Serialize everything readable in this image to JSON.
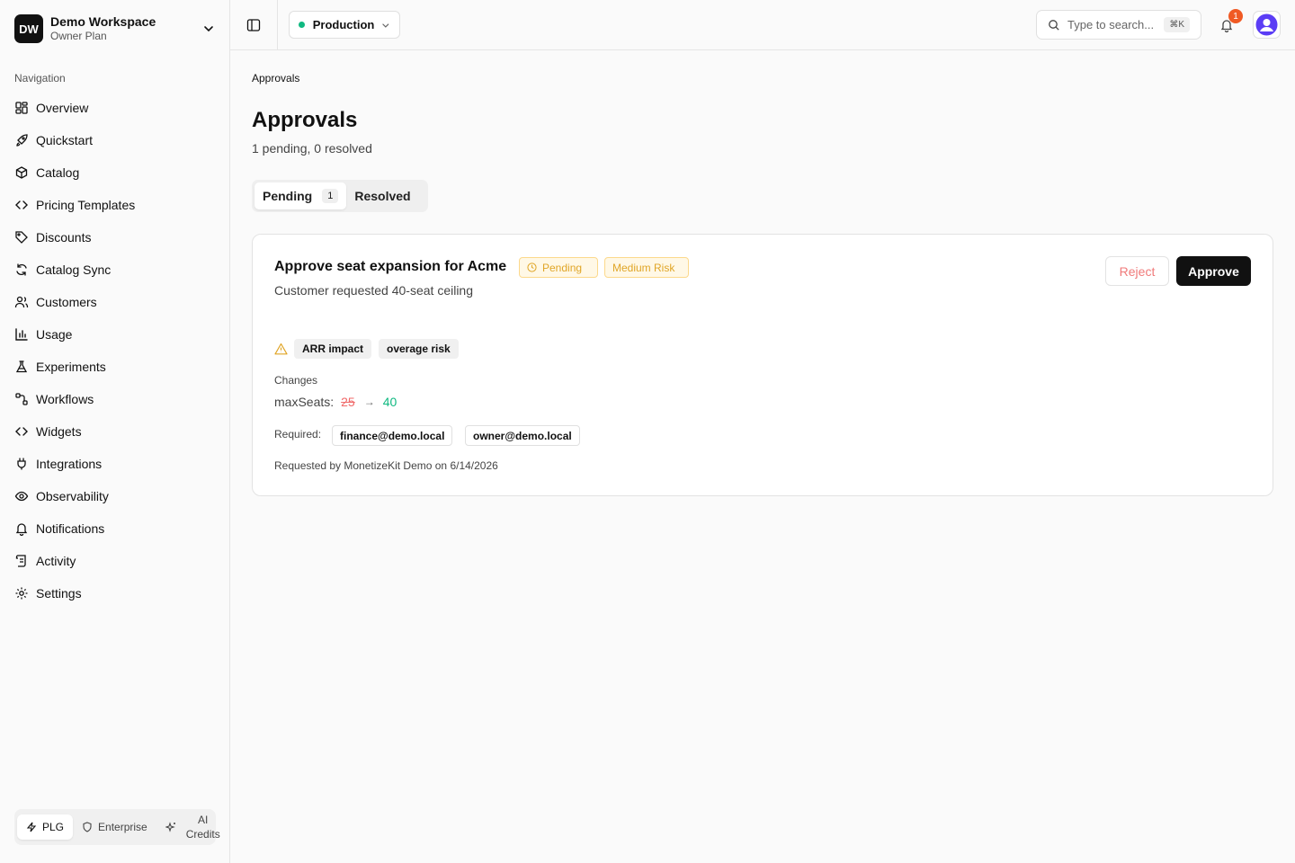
{
  "workspace": {
    "initials": "DW",
    "name": "Demo Workspace",
    "plan": "Owner Plan"
  },
  "nav": {
    "title": "Navigation",
    "items": [
      {
        "label": "Overview",
        "icon": "grid-icon"
      },
      {
        "label": "Quickstart",
        "icon": "rocket-icon"
      },
      {
        "label": "Catalog",
        "icon": "box-icon"
      },
      {
        "label": "Pricing Templates",
        "icon": "code-icon"
      },
      {
        "label": "Discounts",
        "icon": "tag-icon"
      },
      {
        "label": "Catalog Sync",
        "icon": "refresh-icon"
      },
      {
        "label": "Customers",
        "icon": "users-icon"
      },
      {
        "label": "Usage",
        "icon": "bar-chart-icon"
      },
      {
        "label": "Experiments",
        "icon": "flask-icon"
      },
      {
        "label": "Workflows",
        "icon": "workflow-icon"
      },
      {
        "label": "Widgets",
        "icon": "code-icon"
      },
      {
        "label": "Integrations",
        "icon": "plug-icon"
      },
      {
        "label": "Observability",
        "icon": "eye-icon"
      },
      {
        "label": "Notifications",
        "icon": "bell-icon"
      },
      {
        "label": "Activity",
        "icon": "scroll-icon"
      },
      {
        "label": "Settings",
        "icon": "gear-icon"
      }
    ]
  },
  "plan_switch": {
    "plg": "PLG",
    "enterprise": "Enterprise",
    "ai_credits": "AI Credits"
  },
  "topbar": {
    "environment": "Production",
    "search_placeholder": "Type to search...",
    "search_shortcut": "⌘K",
    "notification_count": "1"
  },
  "page": {
    "breadcrumb": "Approvals",
    "title": "Approvals",
    "subtitle": "1 pending, 0 resolved"
  },
  "tabs": {
    "pending": "Pending",
    "pending_count": "1",
    "resolved": "Resolved"
  },
  "approval": {
    "title": "Approve seat expansion for Acme",
    "status": "Pending",
    "risk": "Medium Risk",
    "description": "Customer requested 40-seat ceiling",
    "reject": "Reject",
    "approve": "Approve",
    "tags": [
      "ARR impact",
      "overage risk"
    ],
    "changes_label": "Changes",
    "change_field": "maxSeats:",
    "old_value": "25",
    "arrow": "→",
    "new_value": "40",
    "required_label": "Required:",
    "required": [
      "finance@demo.local",
      "owner@demo.local"
    ],
    "requested_by": "Requested by MonetizeKit Demo on 6/14/2026"
  },
  "colors": {
    "accent": "#111111",
    "success": "#10b981",
    "danger": "#f06a6a",
    "warning": "#e0a526",
    "badge": "#f05a24"
  }
}
